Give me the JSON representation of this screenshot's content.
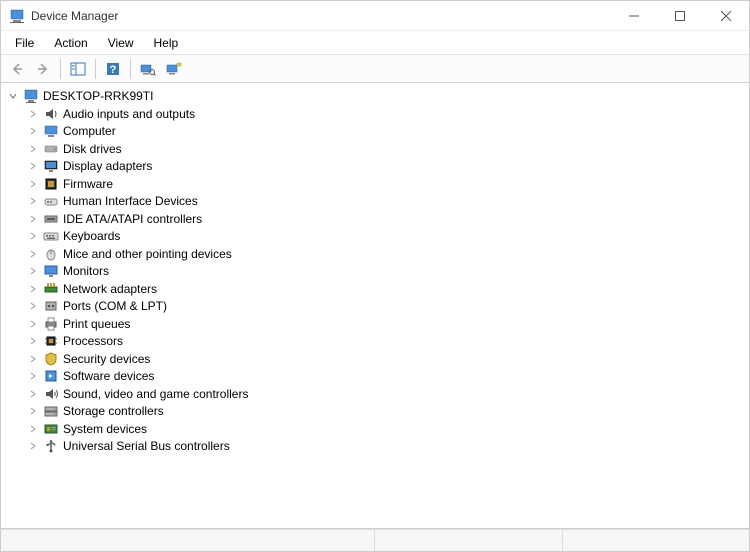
{
  "window": {
    "title": "Device Manager"
  },
  "menu": {
    "file": "File",
    "action": "Action",
    "view": "View",
    "help": "Help"
  },
  "tree": {
    "root": "DESKTOP-RRK99TI",
    "items": [
      {
        "label": "Audio inputs and outputs",
        "icon": "audio"
      },
      {
        "label": "Computer",
        "icon": "computer"
      },
      {
        "label": "Disk drives",
        "icon": "disk"
      },
      {
        "label": "Display adapters",
        "icon": "display"
      },
      {
        "label": "Firmware",
        "icon": "firmware"
      },
      {
        "label": "Human Interface Devices",
        "icon": "hid"
      },
      {
        "label": "IDE ATA/ATAPI controllers",
        "icon": "ide"
      },
      {
        "label": "Keyboards",
        "icon": "keyboard"
      },
      {
        "label": "Mice and other pointing devices",
        "icon": "mouse"
      },
      {
        "label": "Monitors",
        "icon": "monitor"
      },
      {
        "label": "Network adapters",
        "icon": "network"
      },
      {
        "label": "Ports (COM & LPT)",
        "icon": "port"
      },
      {
        "label": "Print queues",
        "icon": "printer"
      },
      {
        "label": "Processors",
        "icon": "cpu"
      },
      {
        "label": "Security devices",
        "icon": "security"
      },
      {
        "label": "Software devices",
        "icon": "software"
      },
      {
        "label": "Sound, video and game controllers",
        "icon": "sound"
      },
      {
        "label": "Storage controllers",
        "icon": "storage"
      },
      {
        "label": "System devices",
        "icon": "system"
      },
      {
        "label": "Universal Serial Bus controllers",
        "icon": "usb"
      }
    ]
  }
}
